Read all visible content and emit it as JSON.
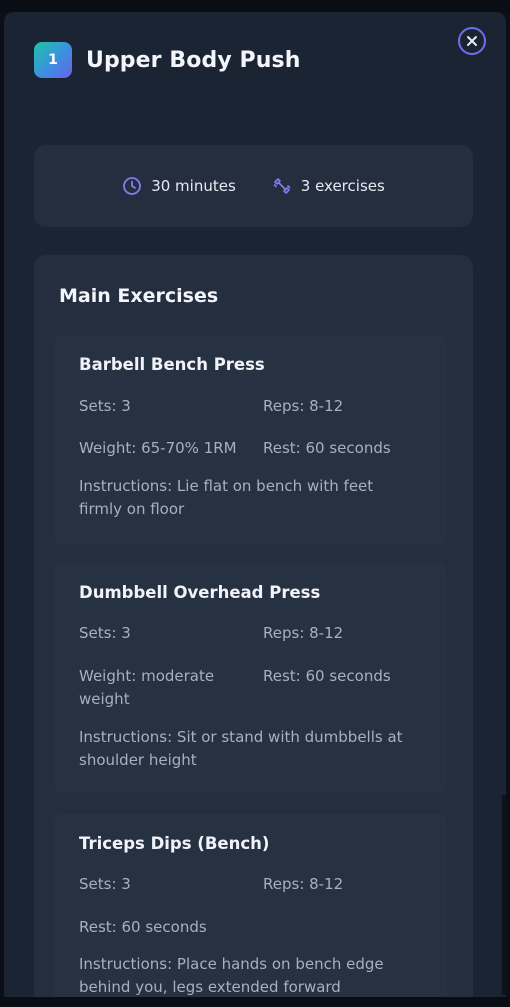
{
  "modal": {
    "day_number": "1",
    "title": "Upper Body Push"
  },
  "summary": {
    "duration": "30 minutes",
    "exercise_count": "3 exercises"
  },
  "icons": {
    "close": "close-icon",
    "clock": "clock-icon",
    "exercises": "dumbbell-icon"
  },
  "colors": {
    "accent": "#6b6ff0",
    "badge_gradient_start": "#22c3a6",
    "badge_gradient_end": "#6a63e8",
    "modal_bg": "#1b2433",
    "card_bg": "#242e3f"
  },
  "section": {
    "title": "Main Exercises"
  },
  "exercises": [
    {
      "name": "Barbell Bench Press",
      "sets": "Sets: 3",
      "reps": "Reps: 8-12",
      "weight": "Weight: 65-70% 1RM",
      "rest": "Rest: 60 seconds",
      "instructions": "Instructions: Lie flat on bench with feet firmly on floor"
    },
    {
      "name": "Dumbbell Overhead Press",
      "sets": "Sets: 3",
      "reps": "Reps: 8-12",
      "weight": "Weight: moderate weight",
      "rest": "Rest: 60 seconds",
      "instructions": "Instructions: Sit or stand with dumbbells at shoulder height"
    },
    {
      "name": "Triceps Dips (Bench)",
      "sets": "Sets: 3",
      "reps": "Reps: 8-12",
      "rest": "Rest: 60 seconds",
      "instructions": "Instructions: Place hands on bench edge behind you, legs extended forward"
    }
  ]
}
